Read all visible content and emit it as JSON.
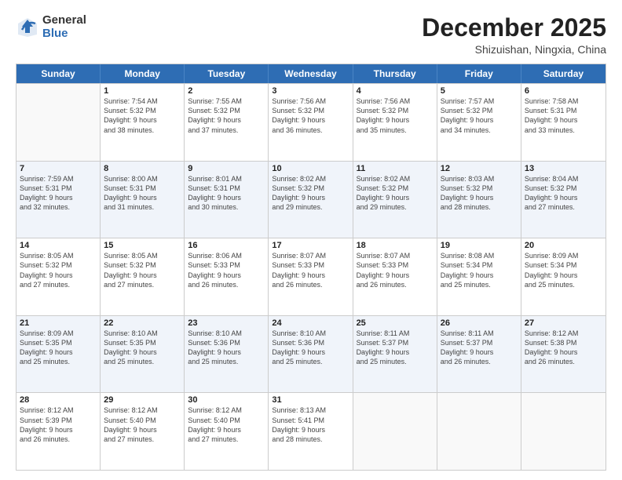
{
  "logo": {
    "general": "General",
    "blue": "Blue"
  },
  "title": "December 2025",
  "location": "Shizuishan, Ningxia, China",
  "days": [
    "Sunday",
    "Monday",
    "Tuesday",
    "Wednesday",
    "Thursday",
    "Friday",
    "Saturday"
  ],
  "weeks": [
    [
      {
        "day": "",
        "info": ""
      },
      {
        "day": "1",
        "info": "Sunrise: 7:54 AM\nSunset: 5:32 PM\nDaylight: 9 hours\nand 38 minutes."
      },
      {
        "day": "2",
        "info": "Sunrise: 7:55 AM\nSunset: 5:32 PM\nDaylight: 9 hours\nand 37 minutes."
      },
      {
        "day": "3",
        "info": "Sunrise: 7:56 AM\nSunset: 5:32 PM\nDaylight: 9 hours\nand 36 minutes."
      },
      {
        "day": "4",
        "info": "Sunrise: 7:56 AM\nSunset: 5:32 PM\nDaylight: 9 hours\nand 35 minutes."
      },
      {
        "day": "5",
        "info": "Sunrise: 7:57 AM\nSunset: 5:32 PM\nDaylight: 9 hours\nand 34 minutes."
      },
      {
        "day": "6",
        "info": "Sunrise: 7:58 AM\nSunset: 5:31 PM\nDaylight: 9 hours\nand 33 minutes."
      }
    ],
    [
      {
        "day": "7",
        "info": "Sunrise: 7:59 AM\nSunset: 5:31 PM\nDaylight: 9 hours\nand 32 minutes."
      },
      {
        "day": "8",
        "info": "Sunrise: 8:00 AM\nSunset: 5:31 PM\nDaylight: 9 hours\nand 31 minutes."
      },
      {
        "day": "9",
        "info": "Sunrise: 8:01 AM\nSunset: 5:31 PM\nDaylight: 9 hours\nand 30 minutes."
      },
      {
        "day": "10",
        "info": "Sunrise: 8:02 AM\nSunset: 5:32 PM\nDaylight: 9 hours\nand 29 minutes."
      },
      {
        "day": "11",
        "info": "Sunrise: 8:02 AM\nSunset: 5:32 PM\nDaylight: 9 hours\nand 29 minutes."
      },
      {
        "day": "12",
        "info": "Sunrise: 8:03 AM\nSunset: 5:32 PM\nDaylight: 9 hours\nand 28 minutes."
      },
      {
        "day": "13",
        "info": "Sunrise: 8:04 AM\nSunset: 5:32 PM\nDaylight: 9 hours\nand 27 minutes."
      }
    ],
    [
      {
        "day": "14",
        "info": "Sunrise: 8:05 AM\nSunset: 5:32 PM\nDaylight: 9 hours\nand 27 minutes."
      },
      {
        "day": "15",
        "info": "Sunrise: 8:05 AM\nSunset: 5:32 PM\nDaylight: 9 hours\nand 27 minutes."
      },
      {
        "day": "16",
        "info": "Sunrise: 8:06 AM\nSunset: 5:33 PM\nDaylight: 9 hours\nand 26 minutes."
      },
      {
        "day": "17",
        "info": "Sunrise: 8:07 AM\nSunset: 5:33 PM\nDaylight: 9 hours\nand 26 minutes."
      },
      {
        "day": "18",
        "info": "Sunrise: 8:07 AM\nSunset: 5:33 PM\nDaylight: 9 hours\nand 26 minutes."
      },
      {
        "day": "19",
        "info": "Sunrise: 8:08 AM\nSunset: 5:34 PM\nDaylight: 9 hours\nand 25 minutes."
      },
      {
        "day": "20",
        "info": "Sunrise: 8:09 AM\nSunset: 5:34 PM\nDaylight: 9 hours\nand 25 minutes."
      }
    ],
    [
      {
        "day": "21",
        "info": "Sunrise: 8:09 AM\nSunset: 5:35 PM\nDaylight: 9 hours\nand 25 minutes."
      },
      {
        "day": "22",
        "info": "Sunrise: 8:10 AM\nSunset: 5:35 PM\nDaylight: 9 hours\nand 25 minutes."
      },
      {
        "day": "23",
        "info": "Sunrise: 8:10 AM\nSunset: 5:36 PM\nDaylight: 9 hours\nand 25 minutes."
      },
      {
        "day": "24",
        "info": "Sunrise: 8:10 AM\nSunset: 5:36 PM\nDaylight: 9 hours\nand 25 minutes."
      },
      {
        "day": "25",
        "info": "Sunrise: 8:11 AM\nSunset: 5:37 PM\nDaylight: 9 hours\nand 25 minutes."
      },
      {
        "day": "26",
        "info": "Sunrise: 8:11 AM\nSunset: 5:37 PM\nDaylight: 9 hours\nand 26 minutes."
      },
      {
        "day": "27",
        "info": "Sunrise: 8:12 AM\nSunset: 5:38 PM\nDaylight: 9 hours\nand 26 minutes."
      }
    ],
    [
      {
        "day": "28",
        "info": "Sunrise: 8:12 AM\nSunset: 5:39 PM\nDaylight: 9 hours\nand 26 minutes."
      },
      {
        "day": "29",
        "info": "Sunrise: 8:12 AM\nSunset: 5:40 PM\nDaylight: 9 hours\nand 27 minutes."
      },
      {
        "day": "30",
        "info": "Sunrise: 8:12 AM\nSunset: 5:40 PM\nDaylight: 9 hours\nand 27 minutes."
      },
      {
        "day": "31",
        "info": "Sunrise: 8:13 AM\nSunset: 5:41 PM\nDaylight: 9 hours\nand 28 minutes."
      },
      {
        "day": "",
        "info": ""
      },
      {
        "day": "",
        "info": ""
      },
      {
        "day": "",
        "info": ""
      }
    ]
  ]
}
